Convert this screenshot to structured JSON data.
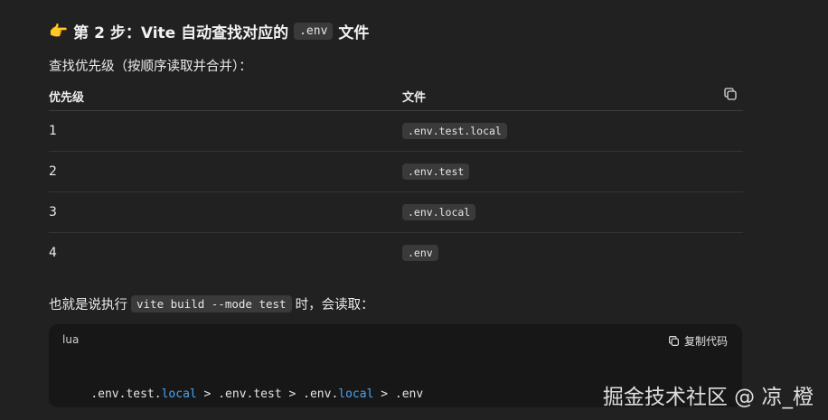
{
  "heading": {
    "emoji": "👉",
    "prefix": "第 2 步：Vite 自动查找对应的",
    "code": ".env",
    "suffix": "文件"
  },
  "intro": "查找优先级（按顺序读取并合并）：",
  "table": {
    "headers": [
      "优先级",
      "文件"
    ],
    "rows": [
      {
        "priority": "1",
        "file": ".env.test.local"
      },
      {
        "priority": "2",
        "file": ".env.test"
      },
      {
        "priority": "3",
        "file": ".env.local"
      },
      {
        "priority": "4",
        "file": ".env"
      }
    ]
  },
  "paragraph": {
    "prefix": "也就是说执行",
    "code": "vite build --mode test",
    "suffix": "时，会读取："
  },
  "codeblock": {
    "language": "lua",
    "copy_label": "复制代码",
    "tokens": [
      {
        "text": ".env.test.",
        "kw": false
      },
      {
        "text": "local",
        "kw": true
      },
      {
        "text": " > .env.test > .env.",
        "kw": false
      },
      {
        "text": "local",
        "kw": true
      },
      {
        "text": " > .env",
        "kw": false
      }
    ]
  },
  "watermark": "掘金技术社区 @ 凉_橙",
  "icons": {
    "heading": "pointing-hand-icon",
    "table_copy": "copy-icon",
    "code_copy": "copy-icon"
  },
  "colors": {
    "background": "#212121",
    "code_bg": "#171717",
    "inline_code_bg": "#3a3a3a",
    "keyword": "#4aa3f0"
  }
}
